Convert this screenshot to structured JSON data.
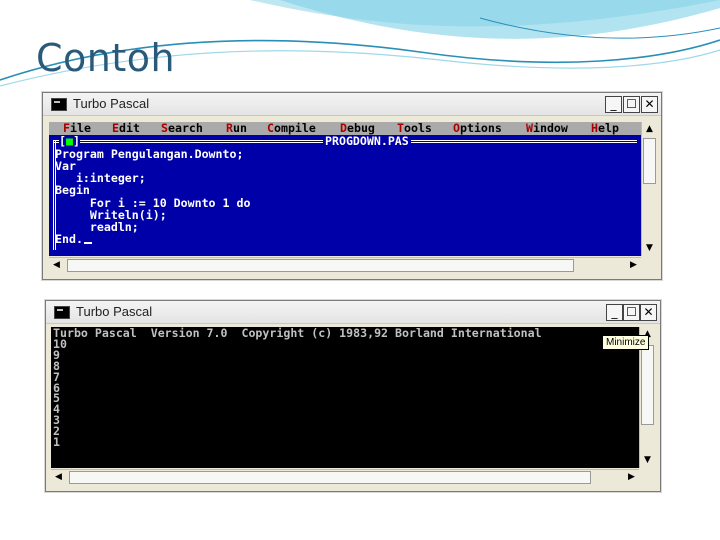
{
  "slide": {
    "title": "Contoh"
  },
  "editor_window": {
    "title": "Turbo Pascal",
    "buttons": {
      "minimize": "_",
      "maximize": "☐",
      "close": "✕"
    },
    "menu": [
      {
        "hotkey": "F",
        "rest": "ile"
      },
      {
        "hotkey": "E",
        "rest": "dit"
      },
      {
        "hotkey": "S",
        "rest": "earch"
      },
      {
        "hotkey": "R",
        "rest": "un"
      },
      {
        "hotkey": "C",
        "rest": "ompile"
      },
      {
        "hotkey": "D",
        "rest": "ebug"
      },
      {
        "hotkey": "T",
        "rest": "ools"
      },
      {
        "hotkey": "O",
        "rest": "ptions"
      },
      {
        "hotkey": "W",
        "rest": "indow"
      },
      {
        "hotkey": "H",
        "rest": "elp"
      }
    ],
    "close_box_left": "[",
    "close_box_mark": "■",
    "close_box_right": "]",
    "filename": "PROGDOWN.PAS",
    "code": [
      "Program Pengulangan.Downto;",
      "Var",
      "   i:integer;",
      "Begin",
      "     For i := 10 Downto 1 do",
      "     Writeln(i);",
      "     readln;",
      "End."
    ]
  },
  "output_window": {
    "title": "Turbo Pascal",
    "buttons": {
      "minimize": "_",
      "maximize": "☐",
      "close": "✕"
    },
    "tooltip": "Minimize",
    "lines": [
      "Turbo Pascal  Version 7.0  Copyright (c) 1983,92 Borland International",
      "10",
      "9",
      "8",
      "7",
      "6",
      "5",
      "4",
      "3",
      "2",
      "1"
    ]
  },
  "icons": {
    "scroll_up": "▲",
    "scroll_down": "▼",
    "scroll_left": "◀",
    "scroll_right": "▶"
  },
  "colors": {
    "dos_blue": "#0000a8",
    "menu_gray": "#aaaaaa",
    "hotkey_red": "#a80000",
    "title_teal": "#2a5a7a"
  }
}
